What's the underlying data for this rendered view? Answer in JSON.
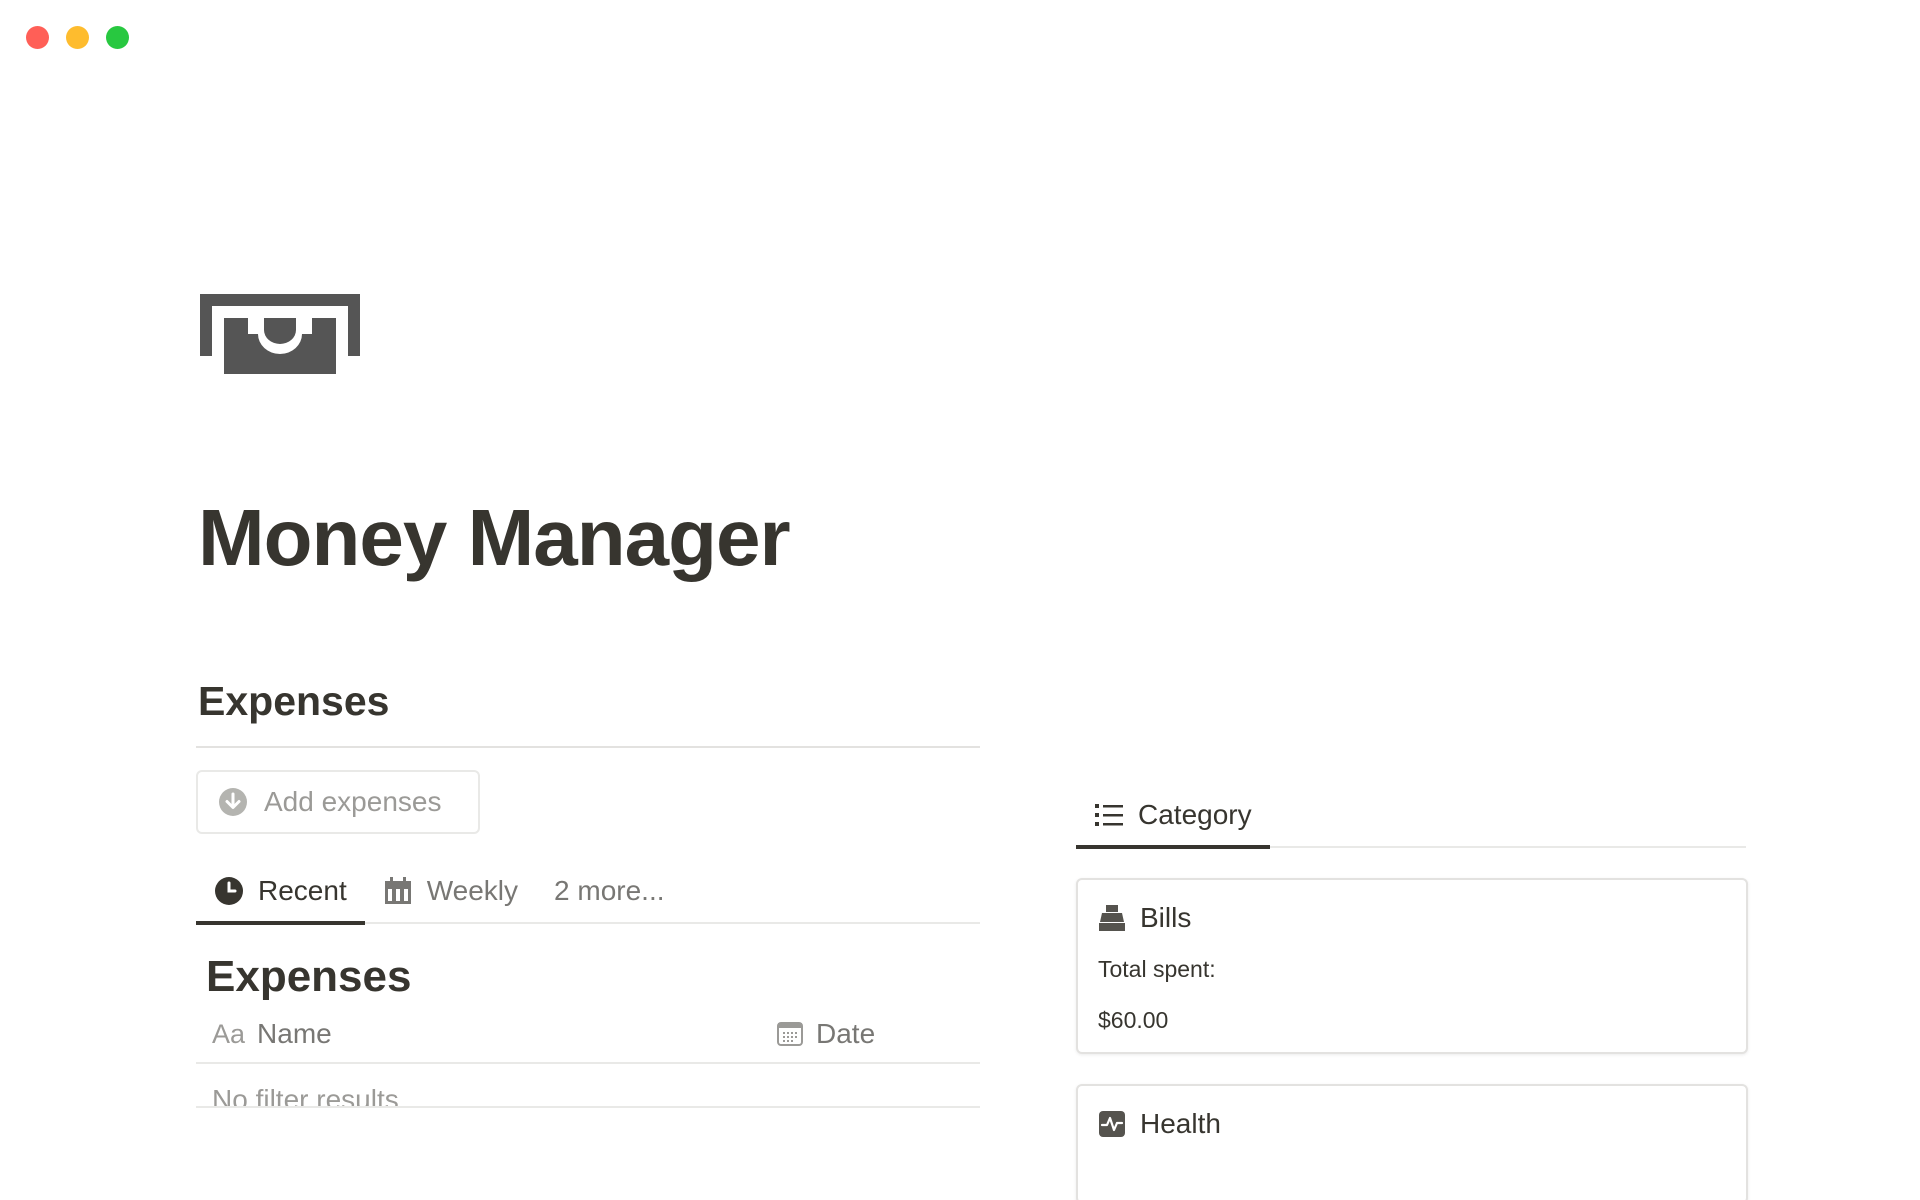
{
  "window": {
    "controls": [
      "close",
      "minimize",
      "zoom"
    ]
  },
  "page": {
    "icon": "money-bill-icon",
    "title": "Money Manager"
  },
  "expenses_section": {
    "heading": "Expenses",
    "add_button": {
      "label": "Add expenses",
      "icon": "arrow-down-circle-icon"
    },
    "tabs": [
      {
        "label": "Recent",
        "icon": "clock-icon",
        "active": true
      },
      {
        "label": "Weekly",
        "icon": "calendar-icon",
        "active": false
      },
      {
        "label": "2 more...",
        "icon": "",
        "active": false
      }
    ],
    "database": {
      "title": "Expenses",
      "columns": [
        {
          "label": "Name",
          "icon_text": "Aa"
        },
        {
          "label": "Date",
          "icon": "calendar-icon"
        }
      ],
      "empty_message": "No filter results."
    }
  },
  "category_section": {
    "tab": {
      "label": "Category",
      "icon": "list-icon"
    },
    "cards": [
      {
        "title": "Bills",
        "icon": "bills-icon",
        "label": "Total spent:",
        "value": "$60.00"
      },
      {
        "title": "Health",
        "icon": "pulse-icon"
      }
    ]
  },
  "colors": {
    "text": "#37352f",
    "muted": "#9b9a97",
    "divider": "#e9e9e7",
    "traffic_red": "#ff5f57",
    "traffic_yellow": "#febc2e",
    "traffic_green": "#28c840"
  }
}
